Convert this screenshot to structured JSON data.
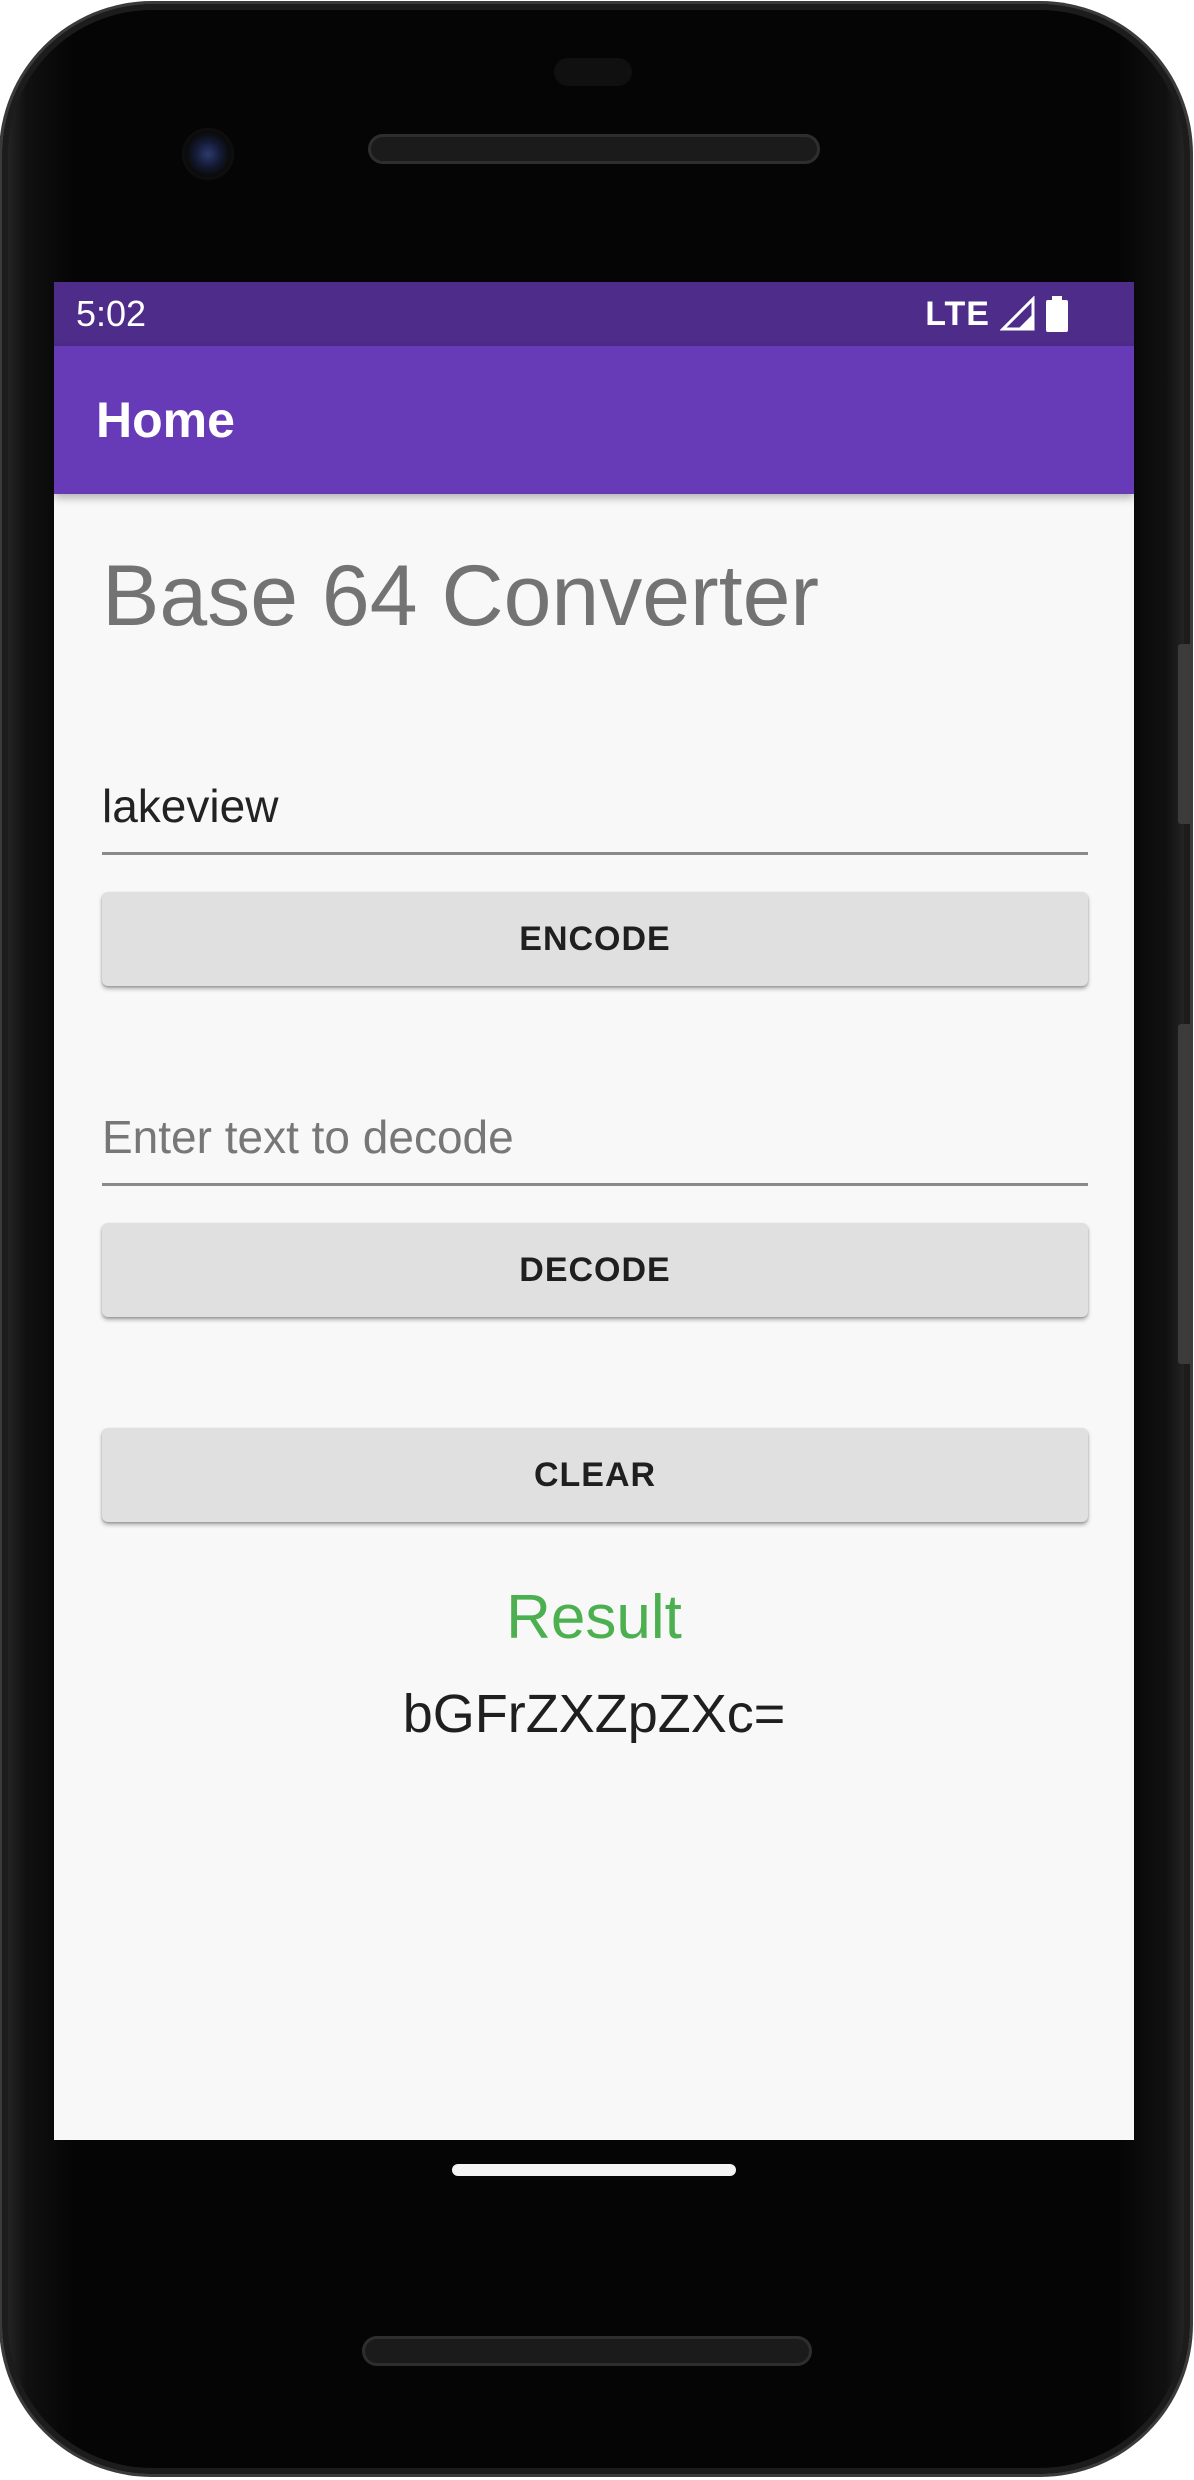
{
  "status_bar": {
    "time": "5:02",
    "network": "LTE",
    "signal_icon": "signal-icon",
    "battery_icon": "battery-icon"
  },
  "app_bar": {
    "title": "Home",
    "color": "#673ab7",
    "status_color": "#4e2c8a"
  },
  "main": {
    "heading": "Base 64 Converter",
    "encode_input": {
      "value": "lakeview",
      "placeholder": ""
    },
    "encode_button": "ENCODE",
    "decode_input": {
      "value": "",
      "placeholder": "Enter text to decode"
    },
    "decode_button": "DECODE",
    "clear_button": "CLEAR",
    "result_label": "Result",
    "result_value": "bGFrZXZpZXc=",
    "result_color": "#4caf50"
  }
}
